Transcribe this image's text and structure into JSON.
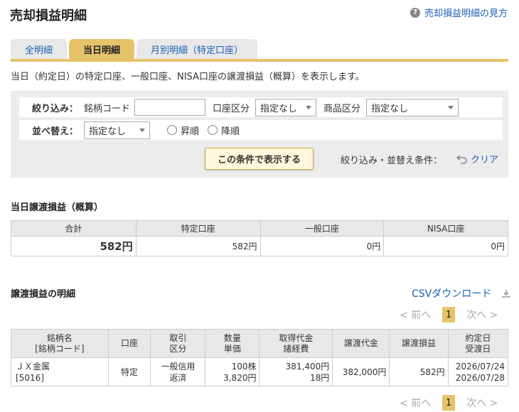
{
  "page": {
    "title": "売却損益明細",
    "help_link": "売却損益明細の見方"
  },
  "tabs": [
    {
      "label": "全明細",
      "active": false
    },
    {
      "label": "当日明細",
      "active": true
    },
    {
      "label": "月別明細（特定口座）",
      "active": false
    }
  ],
  "description": "当日（約定日）の特定口座、一般口座、NISA口座の譲渡損益（概算）を表示します。",
  "filter": {
    "narrow_label": "絞り込み：",
    "code_label": "銘柄コード",
    "code_value": "",
    "account_label": "口座区分",
    "account_value": "指定なし",
    "product_label": "商品区分",
    "product_value": "指定なし",
    "sort_label": "並べ替え：",
    "sort_value": "指定なし",
    "asc_label": "昇順",
    "desc_label": "降順",
    "submit_label": "この条件で表示する",
    "cond_label": "絞り込み・並替え条件：",
    "clear_label": "クリア"
  },
  "summary": {
    "heading": "当日譲渡損益（概算）",
    "headers": [
      "合計",
      "特定口座",
      "一般口座",
      "NISA口座"
    ],
    "values": [
      "582円",
      "582円",
      "0円",
      "0円"
    ]
  },
  "detail": {
    "heading": "譲渡損益の明細",
    "csv_label": "CSVダウンロード",
    "pager": {
      "prev": "< 前へ",
      "current": "1",
      "next": "次へ >"
    },
    "headers": [
      [
        "銘柄名",
        "[銘柄コード]"
      ],
      [
        "口座"
      ],
      [
        "取引",
        "区分"
      ],
      [
        "数量",
        "単価"
      ],
      [
        "取得代金",
        "諸経費"
      ],
      [
        "譲渡代金"
      ],
      [
        "譲渡損益"
      ],
      [
        "約定日",
        "受渡日"
      ]
    ],
    "rows": [
      {
        "name": "ＪＸ金属",
        "code": "[5016]",
        "account": "特定",
        "type1": "一般信用",
        "type2": "返済",
        "qty": "100株",
        "price": "3,820円",
        "cost": "381,400円",
        "fee": "18円",
        "proceeds": "382,000円",
        "pl": "582円",
        "trade_date": "2026/07/24",
        "settle_date": "2026/07/28"
      }
    ]
  },
  "colors": {
    "accent": "#e6c36a",
    "link": "#1a5fb4"
  }
}
